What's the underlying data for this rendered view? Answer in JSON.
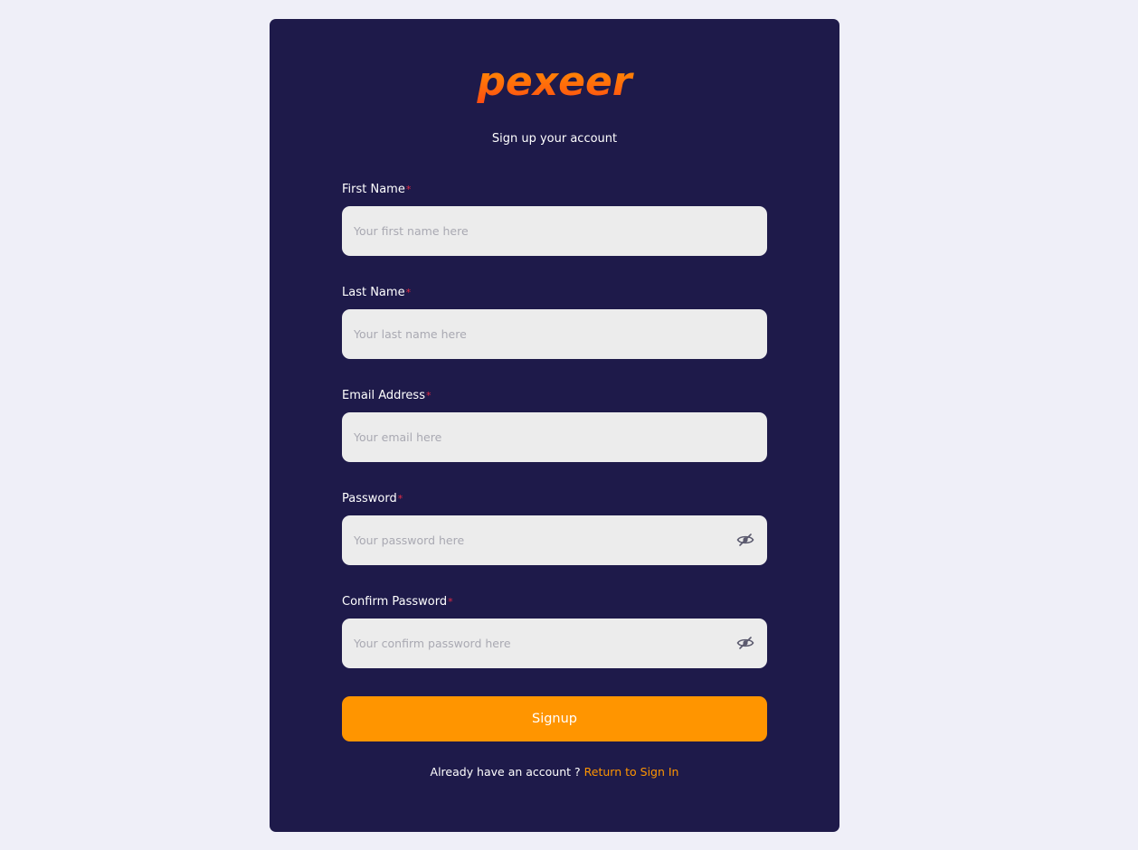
{
  "brand": {
    "name": "pexeer",
    "gradient_top": "#ff9a00",
    "gradient_bottom": "#ff4a12"
  },
  "subtitle": "Sign up your account",
  "form": {
    "first_name": {
      "label": "First Name",
      "required_mark": "*",
      "placeholder": "Your first name here",
      "value": ""
    },
    "last_name": {
      "label": "Last Name",
      "required_mark": "*",
      "placeholder": "Your last name here",
      "value": ""
    },
    "email": {
      "label": "Email Address",
      "required_mark": "*",
      "placeholder": "Your email here",
      "value": ""
    },
    "password": {
      "label": "Password",
      "required_mark": "*",
      "placeholder": "Your password here",
      "value": "",
      "toggle_icon": "eye-slash-icon"
    },
    "confirm_password": {
      "label": "Confirm Password",
      "required_mark": "*",
      "placeholder": "Your confirm password here",
      "value": "",
      "toggle_icon": "eye-slash-icon"
    },
    "submit_label": "Signup"
  },
  "footer": {
    "prompt": "Already have an account ?",
    "link_label": "Return to Sign In"
  },
  "colors": {
    "background": "#efeff8",
    "card": "#1e1a4a",
    "input": "#ececec",
    "accent": "#ff9500",
    "required": "#e02b45"
  }
}
